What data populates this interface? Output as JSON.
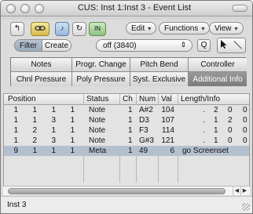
{
  "window": {
    "title": "CUS: Inst 1:Inst 3 - Event List"
  },
  "toolbar": {
    "edit_label": "Edit",
    "functions_label": "Functions",
    "view_label": "View",
    "filter_label": "Filter",
    "create_label": "Create",
    "dropdown_value": "off (3840)",
    "search_icon": "Q"
  },
  "tabs": {
    "row1": [
      "Notes",
      "Progr. Change",
      "Pitch Bend",
      "Controller"
    ],
    "row2": [
      "Chnl Pressure",
      "Poly Pressure",
      "Syst. Exclusive",
      "Additional Info"
    ],
    "selected": "Additional Info"
  },
  "table": {
    "headers": [
      "Position",
      "Status",
      "Ch",
      "Num",
      "Val",
      "Length/Info"
    ],
    "rows": [
      {
        "pos": [
          "1",
          "1",
          "1",
          "1"
        ],
        "status": "Note",
        "ch": "1",
        "num": "A#2",
        "val": "104",
        "info": [
          ".",
          "2",
          "0",
          "0"
        ]
      },
      {
        "pos": [
          "1",
          "1",
          "3",
          "1"
        ],
        "status": "Note",
        "ch": "1",
        "num": "D3",
        "val": "107",
        "info": [
          ".",
          "1",
          "2",
          "0"
        ]
      },
      {
        "pos": [
          "1",
          "2",
          "1",
          "1"
        ],
        "status": "Note",
        "ch": "1",
        "num": "F3",
        "val": "114",
        "info": [
          ".",
          "1",
          "0",
          "0"
        ]
      },
      {
        "pos": [
          "1",
          "2",
          "3",
          "1"
        ],
        "status": "Note",
        "ch": "1",
        "num": "G#3",
        "val": "121",
        "info": [
          ".",
          "1",
          "0",
          "0"
        ]
      },
      {
        "pos": [
          "9",
          "1",
          "1",
          "1"
        ],
        "status": "Meta",
        "ch": "1",
        "num": "49",
        "val": "6",
        "info": [
          "go Screenset"
        ]
      }
    ]
  },
  "status_bar": {
    "text": "Inst 3"
  }
}
